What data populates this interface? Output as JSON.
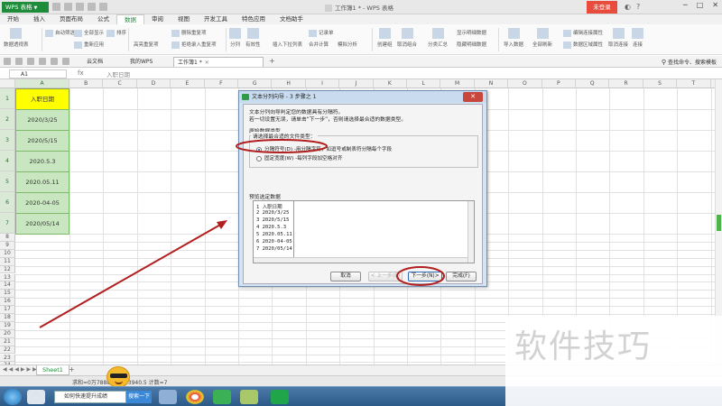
{
  "titlebar": {
    "app_name": "WPS 表格",
    "doc_title": "工作簿1 * - WPS 表格",
    "login": "未登录"
  },
  "tabs": [
    "开始",
    "插入",
    "页面布局",
    "公式",
    "数据",
    "审阅",
    "视图",
    "开发工具",
    "特色应用",
    "文档助手"
  ],
  "active_tab": "数据",
  "ribbon": {
    "pivot": "数据透视表",
    "autofilter": "自动筛选",
    "show_all": "全部显示",
    "reapply": "重新应用",
    "sort": "排序",
    "highlight_dup": "高亮重复项",
    "delete_dup": "删除重复项",
    "reject_dup": "拒绝录入重复项",
    "split": "分列",
    "validity": "有效性",
    "insert_dropdown": "插入下拉列表",
    "record": "记录单",
    "consolidate": "合并计算",
    "what_if": "模拟分析",
    "create_group": "创建组",
    "ungroup": "取消组合",
    "subtotal": "分类汇总",
    "show_detail": "显示明细数据",
    "hide_detail": "隐藏明细数据",
    "import": "导入数据",
    "refresh_all": "全部刷新",
    "edit_links": "编辑连接属性",
    "data_region": "数据区域属性",
    "props": "取消连接",
    "connect": "连接"
  },
  "docbar": {
    "tabs": [
      {
        "label": "云文档"
      },
      {
        "label": "我的WPS"
      },
      {
        "label": "工作簿1 *"
      }
    ],
    "search_cmd": "查找命令、搜索模板"
  },
  "formula_bar": {
    "cell_ref": "A1",
    "fx": "fx",
    "content": "入职日期"
  },
  "columns": [
    "A",
    "B",
    "C",
    "D",
    "E",
    "F",
    "G",
    "H",
    "I",
    "J",
    "K",
    "L",
    "M",
    "N",
    "O",
    "P",
    "Q",
    "R",
    "S",
    "T",
    "U"
  ],
  "cells_A": [
    "入职日期",
    "2020/3/25",
    "2020/5/15",
    "2020.5.3",
    "2020.05.11",
    "2020-04-05",
    "2020/05/14"
  ],
  "row_count": 25,
  "dialog": {
    "title": "文本分列向导 - 3 步骤之 1",
    "intro1": "文本分列向导判定您的数据具有分隔符。",
    "intro2": "若一切设置无误，请单击“下一步”，否则请选择最合适的数据类型。",
    "orig_type_label": "原始数据类型",
    "choose_label": "请选择最合适的文件类型：",
    "radio_delim": "分隔符号(D)",
    "radio_delim_desc": "-用分隔字符，如逗号或制表符分隔每个字段",
    "radio_fixed": "固定宽度(W)",
    "radio_fixed_desc": "-每列字段加空格对齐",
    "preview_label": "预览选定数据",
    "preview_rows": [
      "1 入职日期",
      "2 2020/3/25",
      "3 2020/5/15",
      "4 2020.5.3",
      "5 2020.05.11",
      "6 2020-04-05",
      "7 2020/05/14"
    ],
    "btn_cancel": "取消",
    "btn_prev": "< 上一步(B)",
    "btn_next": "下一步(N)>",
    "btn_finish": "完成(F)",
    "close": "✕"
  },
  "sheet_tab": "Sheet1",
  "status": "求和=0万7888 … 4万3940.5  计数=7",
  "taskbar": {
    "search_text": "如何快速提升成绩",
    "search_btn": "搜索一下"
  },
  "watermark": "软件技巧",
  "colors": {
    "brand_green": "#1f8c3b",
    "login_red": "#e84c3d",
    "header_yellow": "#ffff00",
    "cell_green": "#c8e7c0",
    "annotation_red": "#b21f1f"
  }
}
